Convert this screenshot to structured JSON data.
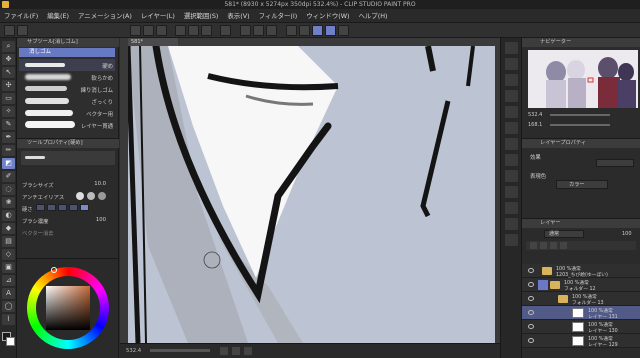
{
  "window": {
    "title": "581* (8930 x 5274px 350dpi 532.4%) - CLIP STUDIO PAINT PRO"
  },
  "menu": [
    "ファイル(F)",
    "編集(E)",
    "アニメーション(A)",
    "レイヤー(L)",
    "選択範囲(S)",
    "表示(V)",
    "フィルター(I)",
    "ウィンドウ(W)",
    "ヘルプ(H)"
  ],
  "canvas_tab": "581*",
  "sub_tool": {
    "header": "サブツール[消しゴム]",
    "current": "消しゴム",
    "brushes": [
      {
        "label": "硬め"
      },
      {
        "label": "軟らかめ"
      },
      {
        "label": "練り消しゴム"
      },
      {
        "label": "ざっくり"
      },
      {
        "label": "ベクター用"
      },
      {
        "label": "レイヤー貫通"
      }
    ]
  },
  "tool_property": {
    "header": "ツールプロパティ[硬め]",
    "current": "硬め",
    "rows": [
      {
        "label": "ブラシサイズ",
        "value": "10.0"
      },
      {
        "label": "アンチエイリアス",
        "value": ""
      },
      {
        "label": "硬さ",
        "value": ""
      },
      {
        "label": "ブラシ濃度",
        "value": "100"
      },
      {
        "label": "ベクター消去",
        "value": ""
      }
    ]
  },
  "navigator": {
    "header": "ナビゲーター",
    "zoom": "532.4",
    "rotation": "168.1"
  },
  "layer_property": {
    "header": "レイヤープロパティ",
    "effect_label": "効果",
    "expression_label": "表現色",
    "expression_value": "カラー"
  },
  "layers": {
    "header": "レイヤー",
    "blend_mode": "通常",
    "opacity": "100",
    "rows": [
      {
        "top": "100 %通常",
        "bottom": "1203_ちび絵(ゆーぼい)",
        "type": "folder",
        "indent": 0,
        "selected": false
      },
      {
        "top": "100 %通常",
        "bottom": "フォルダー 12",
        "type": "folder",
        "indent": 1,
        "selected": false
      },
      {
        "top": "100 %通常",
        "bottom": "フォルダー 13",
        "type": "folder",
        "indent": 2,
        "selected": false
      },
      {
        "top": "100 %通常",
        "bottom": "レイヤー 131",
        "type": "layer",
        "indent": 3,
        "selected": true
      },
      {
        "top": "100 %通常",
        "bottom": "レイヤー 130",
        "type": "layer",
        "indent": 3,
        "selected": false
      },
      {
        "top": "100 %通常",
        "bottom": "レイヤー 129",
        "type": "layer",
        "indent": 3,
        "selected": false
      }
    ]
  },
  "statusbar": {
    "zoom": "532.4"
  },
  "colors": {
    "accent": "#6879c4",
    "canvas_bg": "#bcc3d2",
    "main_color": "#1a1a1a",
    "sub_color": "#ffffff"
  }
}
